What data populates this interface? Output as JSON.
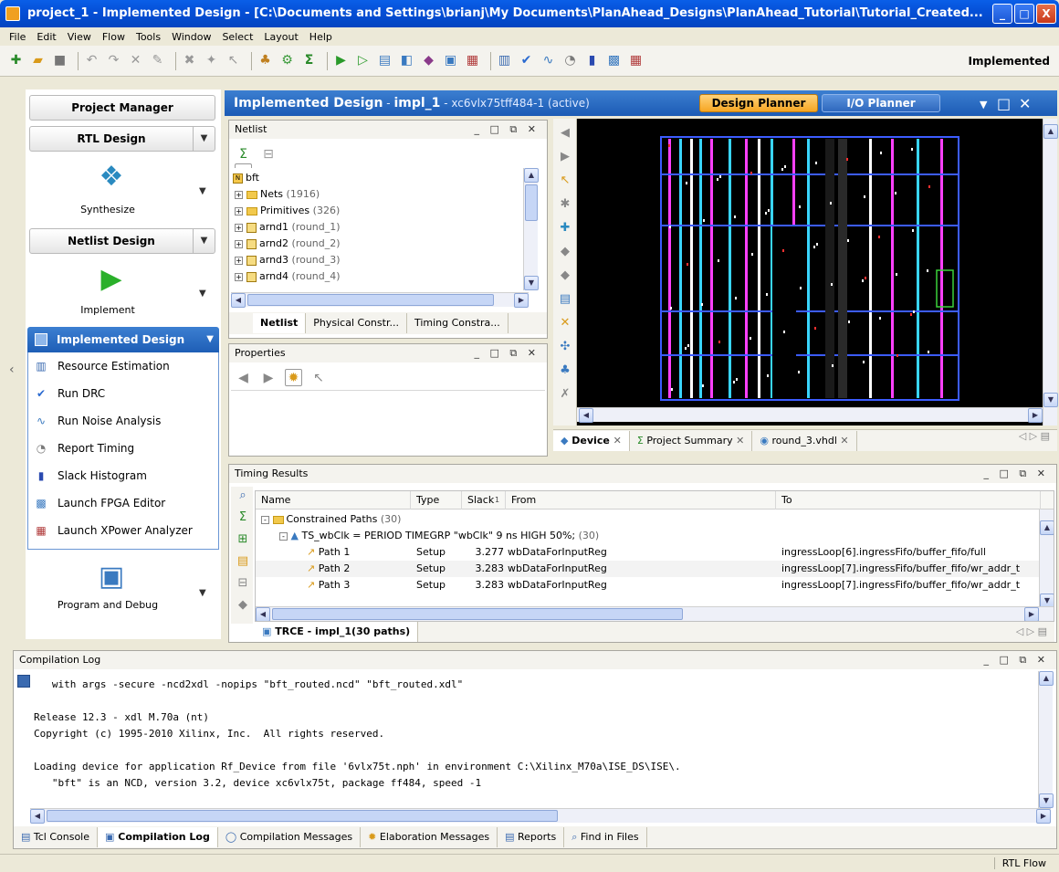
{
  "window": {
    "title": "project_1 - Implemented Design - [C:\\Documents and Settings\\brianj\\My Documents\\PlanAhead_Designs\\PlanAhead_Tutorial\\Tutorial_Created...",
    "min": "_",
    "max": "□",
    "close": "X"
  },
  "menubar": [
    "File",
    "Edit",
    "View",
    "Flow",
    "Tools",
    "Window",
    "Select",
    "Layout",
    "Help"
  ],
  "toolbar": {
    "state_label": "Implemented"
  },
  "flow": {
    "project_manager": "Project Manager",
    "rtl_design": "RTL Design",
    "synthesize": "Synthesize",
    "netlist_design": "Netlist Design",
    "implement": "Implement",
    "implemented_design": "Implemented Design",
    "items": [
      "Resource Estimation",
      "Run DRC",
      "Run Noise Analysis",
      "Report Timing",
      "Slack Histogram",
      "Launch FPGA Editor",
      "Launch XPower Analyzer"
    ],
    "program_debug": "Program and Debug"
  },
  "design": {
    "title": "Implemented Design",
    "sep": " - ",
    "impl": "impl_1",
    "part": " - xc6vlx75tff484-1",
    "active": " (active)",
    "design_planner": "Design Planner",
    "io_planner": "I/O Planner"
  },
  "netlist": {
    "title": "Netlist",
    "root": "bft",
    "rows": [
      {
        "name": "Nets",
        "extra": " (1916)"
      },
      {
        "name": "Primitives",
        "extra": " (326)"
      },
      {
        "name": "arnd1",
        "extra": " (round_1)"
      },
      {
        "name": "arnd2",
        "extra": " (round_2)"
      },
      {
        "name": "arnd3",
        "extra": " (round_3)"
      },
      {
        "name": "arnd4",
        "extra": " (round_4)"
      }
    ],
    "tabs": [
      "Netlist",
      "Physical Constr...",
      "Timing Constra..."
    ]
  },
  "properties": {
    "title": "Properties"
  },
  "device_tabs": [
    "Device",
    "Project Summary",
    "round_3.vhdl"
  ],
  "timing": {
    "title": "Timing Results",
    "columns": [
      "Name",
      "Type",
      "Slack",
      "1",
      "From",
      "To"
    ],
    "group": "Constrained Paths",
    "group_count": " (30)",
    "constraint": "TS_wbClk = PERIOD TIMEGRP \"wbClk\" 9 ns HIGH 50%;",
    "constraint_count": " (30)",
    "rows": [
      {
        "name": "Path 1",
        "type": "Setup",
        "slack": "3.277",
        "from": "wbDataForInputReg",
        "to": "ingressLoop[6].ingressFifo/buffer_fifo/full"
      },
      {
        "name": "Path 2",
        "type": "Setup",
        "slack": "3.283",
        "from": "wbDataForInputReg",
        "to": "ingressLoop[7].ingressFifo/buffer_fifo/wr_addr_t"
      },
      {
        "name": "Path 3",
        "type": "Setup",
        "slack": "3.283",
        "from": "wbDataForInputReg",
        "to": "ingressLoop[7].ingressFifo/buffer_fifo/wr_addr_t"
      }
    ],
    "tab": "TRCE - impl_1(30 paths)"
  },
  "log": {
    "title": "Compilation Log",
    "lines": [
      "   with args -secure -ncd2xdl -nopips \"bft_routed.ncd\" \"bft_routed.xdl\"",
      "",
      "Release 12.3 - xdl M.70a (nt)",
      "Copyright (c) 1995-2010 Xilinx, Inc.  All rights reserved.",
      "",
      "Loading device for application Rf_Device from file '6vlx75t.nph' in environment C:\\Xilinx_M70a\\ISE_DS\\ISE\\.",
      "   \"bft\" is an NCD, version 3.2, device xc6vlx75t, package ff484, speed -1"
    ],
    "tabs": [
      "Tcl Console",
      "Compilation Log",
      "Compilation Messages",
      "Elaboration Messages",
      "Reports",
      "Find in Files"
    ]
  },
  "status": {
    "flow": "RTL Flow"
  }
}
